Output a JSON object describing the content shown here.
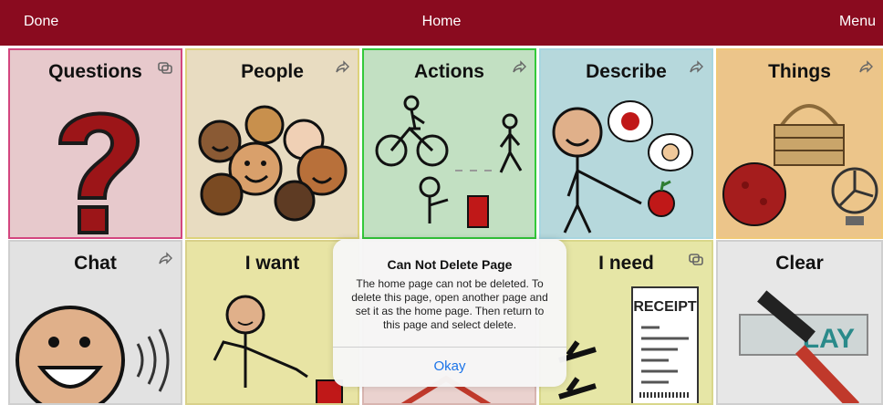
{
  "topbar": {
    "left_button": "Done",
    "title": "Home",
    "right_button": "Menu",
    "bg_color": "#8a0b1f"
  },
  "tiles": [
    {
      "label": "Questions",
      "corner_icon": "link-icon"
    },
    {
      "label": "People",
      "corner_icon": "share-arrow-icon"
    },
    {
      "label": "Actions",
      "corner_icon": "share-arrow-icon"
    },
    {
      "label": "Describe",
      "corner_icon": "share-arrow-icon"
    },
    {
      "label": "Things",
      "corner_icon": "share-arrow-icon"
    },
    {
      "label": "Chat",
      "corner_icon": "share-arrow-icon"
    },
    {
      "label": "I want",
      "corner_icon": ""
    },
    {
      "label": "",
      "corner_icon": ""
    },
    {
      "label": "I need",
      "corner_icon": "link-icon"
    },
    {
      "label": "Clear",
      "corner_icon": ""
    }
  ],
  "clear_sign_text": "LAY",
  "receipt_text": "RECEIPT",
  "alert": {
    "title": "Can Not Delete Page",
    "message": "The home page can not be deleted. To delete this page, open another page and set it as the home page. Then return to this page and select delete.",
    "button": "Okay",
    "accent_color": "#1a73e8"
  }
}
